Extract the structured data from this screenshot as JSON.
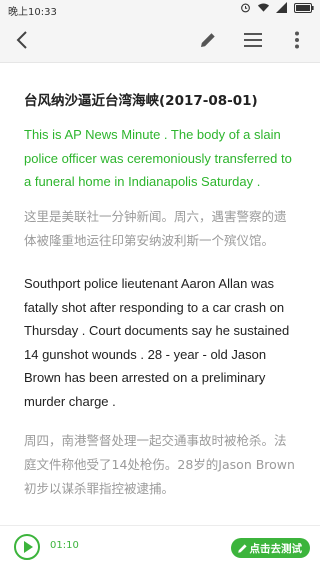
{
  "status_bar": {
    "time": "晚上10:33",
    "icons": [
      "alarm-icon",
      "wifi-icon",
      "signal-icon",
      "battery-icon"
    ]
  },
  "toolbar": {
    "back_icon": "back-arrow-icon",
    "edit_icon": "pencil-icon",
    "list_icon": "menu-lines-icon",
    "more_icon": "more-vert-icon"
  },
  "article": {
    "title": "台风纳沙逼近台湾海峡(2017-08-01)",
    "paragraphs": [
      {
        "type": "english-highlight",
        "lines": [
          "This is AP News Minute . The body of a slain",
          "police officer was ceremoniously transferred to",
          "a funeral home in Indianapolis Saturday ."
        ]
      },
      {
        "type": "chinese",
        "lines": [
          "这里是美联社一分钟新闻。周六，遇害警察的遗",
          "体被隆重地运往印第安纳波利斯一个殡仪馆。"
        ]
      },
      {
        "type": "english",
        "lines": [
          "Southport police lieutenant Aaron Allan was",
          "fatally shot after responding to a car crash on",
          "Thursday . Court documents say he sustained",
          "14 gunshot wounds . 28 - year - old Jason",
          "Brown has been arrested on a preliminary",
          "murder charge ."
        ]
      },
      {
        "type": "chinese",
        "lines": [
          "周四，南港警督处理一起交通事故时被枪杀。法",
          "庭文件称他受了14处枪伤。28岁的Jason Brown",
          "初步以谋杀罪指控被逮捕。"
        ]
      }
    ]
  },
  "player": {
    "elapsed": "01:10",
    "test_button_label": "点击去测试"
  },
  "colors": {
    "accent_green": "#3cb43c",
    "highlight_text": "#2db52d",
    "translation_grey": "#9b9b9b"
  }
}
